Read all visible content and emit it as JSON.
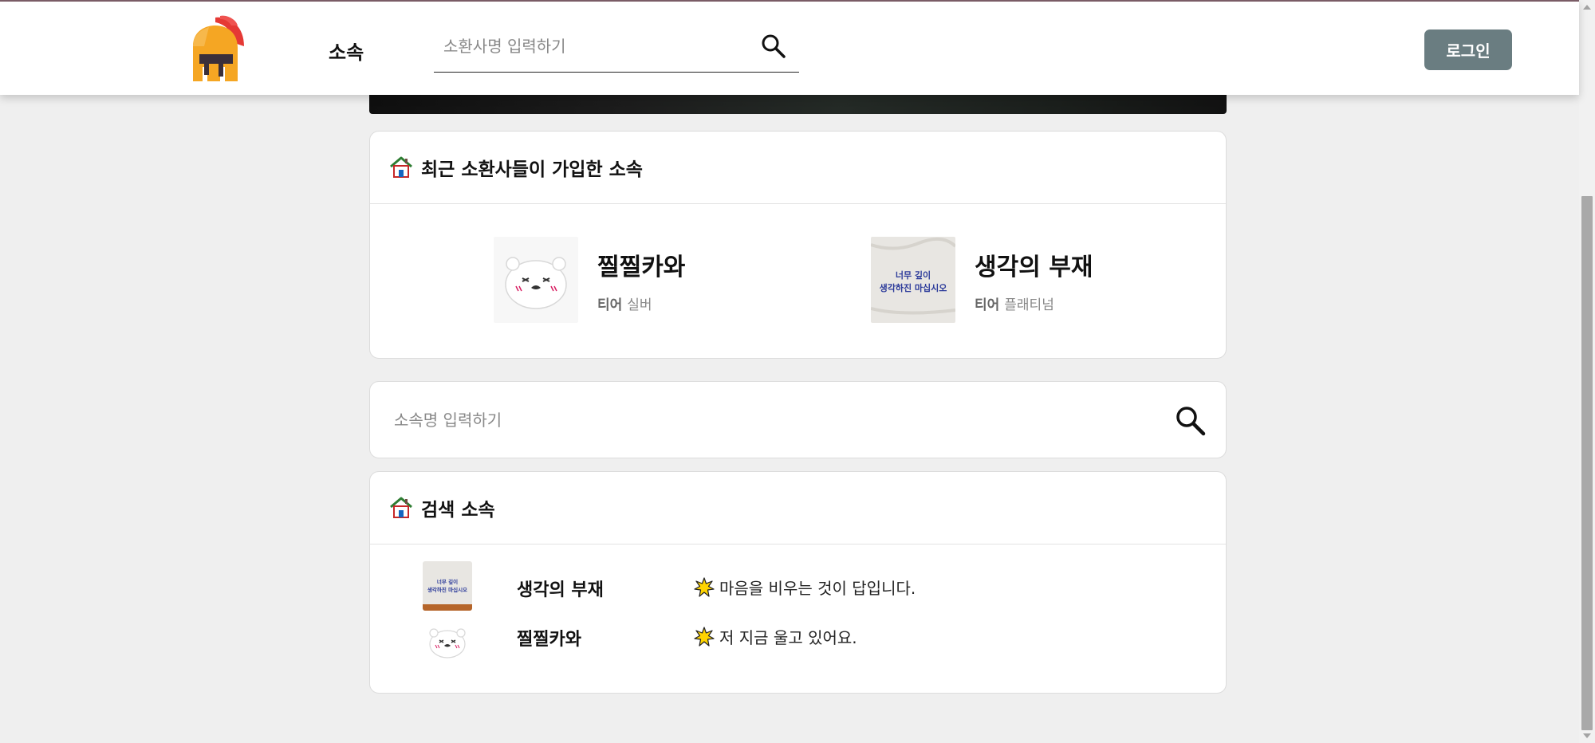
{
  "header": {
    "logo_icon": "spartan-helmet-icon",
    "nav_club_label": "소속",
    "summoner_search": {
      "placeholder": "소환사명 입력하기",
      "icon": "search-icon"
    },
    "login_label": "로그인"
  },
  "recent_clubs": {
    "title": "최근 소환사들이 가입한 소속",
    "icon": "house-icon",
    "items": [
      {
        "name": "찔찔카와",
        "tier_label": "티어",
        "tier": "실버"
      },
      {
        "name": "생각의 부재",
        "tier_label": "티어",
        "tier": "플래티넘",
        "thumb_text": [
          "너무 깊이",
          "생각하진 마십시오"
        ]
      }
    ]
  },
  "club_search": {
    "placeholder": "소속명 입력하기",
    "icon": "search-icon"
  },
  "search_results": {
    "title": "검색 소속",
    "icon": "house-icon",
    "rows": [
      {
        "name": "생각의 부재",
        "motto": "마음을 비우는 것이 답입니다.",
        "motto_icon": "sparkle-icon"
      },
      {
        "name": "찔찔카와",
        "motto": "저 지금 울고 있어요.",
        "motto_icon": "sparkle-icon"
      }
    ]
  },
  "colors": {
    "login_button": "#6a7d81",
    "page_background": "#efefef",
    "logo_helmet": "#f5a623",
    "logo_crest": "#e53935"
  }
}
